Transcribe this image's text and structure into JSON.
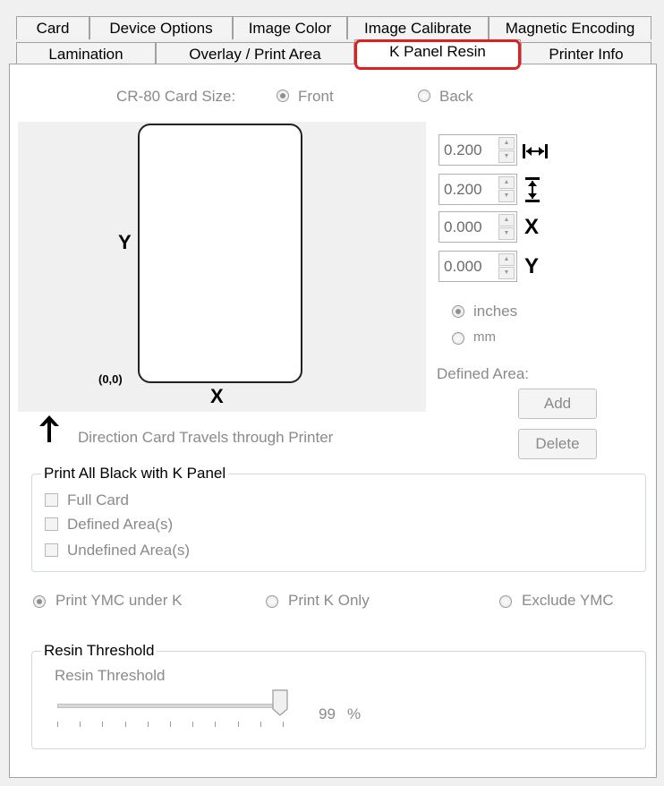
{
  "tabs_row1": [
    "Card",
    "Device Options",
    "Image Color",
    "Image Calibrate",
    "Magnetic Encoding"
  ],
  "tabs_row2": [
    "Lamination",
    "Overlay / Print Area",
    "K Panel Resin",
    "Printer Info"
  ],
  "card_size": {
    "label": "CR-80 Card Size:",
    "front": "Front",
    "back": "Back",
    "selected": "Front"
  },
  "preview": {
    "y_label": "Y",
    "x_label": "X",
    "origin": "(0,0)"
  },
  "direction_text": "Direction Card Travels through Printer",
  "spinners": [
    {
      "value": "0.200",
      "icon": "width-icon"
    },
    {
      "value": "0.200",
      "icon": "height-icon"
    },
    {
      "value": "0.000",
      "icon_text": "X"
    },
    {
      "value": "0.000",
      "icon_text": "Y"
    }
  ],
  "units": {
    "inches": "inches",
    "mm": "mm",
    "selected": "inches"
  },
  "defined_area": {
    "label": "Defined Area:",
    "add": "Add",
    "delete": "Delete"
  },
  "print_black": {
    "legend": "Print All Black with K Panel",
    "options": [
      "Full Card",
      "Defined Area(s)",
      "Undefined Area(s)"
    ]
  },
  "print_mode": {
    "ymc_under_k": "Print YMC under K",
    "k_only": "Print K Only",
    "exclude_ymc": "Exclude YMC",
    "selected": "Print YMC under K"
  },
  "resin": {
    "legend": "Resin Threshold",
    "label": "Resin Threshold",
    "value": "99",
    "unit": "%",
    "level": 0.99
  }
}
